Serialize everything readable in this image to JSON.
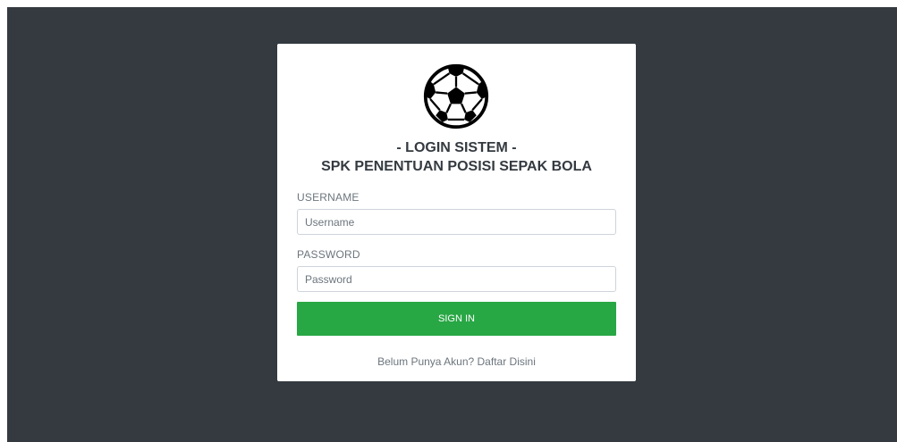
{
  "login": {
    "logo_icon": "soccer-ball-icon",
    "title": "- LOGIN SISTEM -",
    "subtitle": "SPK PENENTUAN POSISI SEPAK BOLA",
    "username_label": "USERNAME",
    "username_placeholder": "Username",
    "username_value": "",
    "password_label": "PASSWORD",
    "password_placeholder": "Password",
    "password_value": "",
    "signin_label": "SIGN IN",
    "register_link": "Belum Punya Akun? Daftar Disini"
  },
  "colors": {
    "background": "#343a40",
    "card": "#ffffff",
    "primary_button": "#28a745"
  }
}
